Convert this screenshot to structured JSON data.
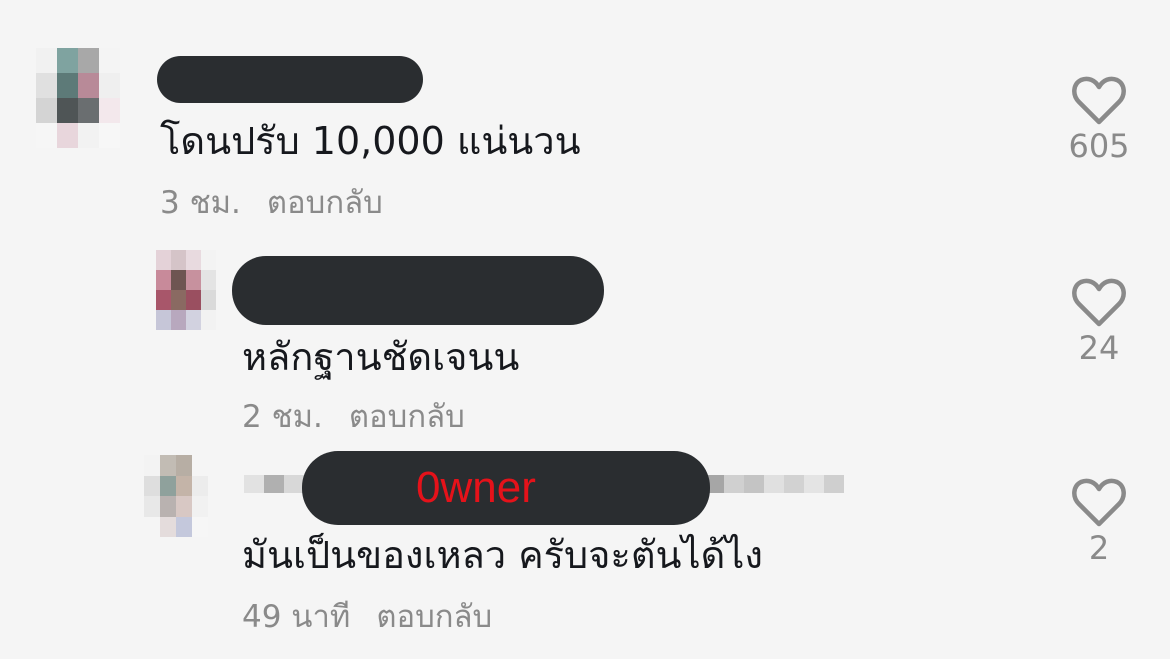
{
  "comments": [
    {
      "text": "โดนปรับ 10,000 แน่นวน",
      "time": "3 ชม.",
      "reply_label": "ตอบกลับ",
      "likes": "605"
    },
    {
      "text": "หลักฐานชัดเจนน",
      "time": "2 ชม.",
      "reply_label": "ตอบกลับ",
      "likes": "24"
    },
    {
      "text": "มันเป็นของเหลว ครับจะตันได้ไง",
      "time": "49 นาที",
      "reply_label": "ตอบกลับ",
      "likes": "2",
      "owner_label": "0wner"
    }
  ],
  "colors": {
    "background": "#f5f5f5",
    "text": "#16181d",
    "secondary_text": "#8a8a8a",
    "redaction_bar": "#2a2d30",
    "owner_label": "#e5121a"
  },
  "icons": {
    "like": "heart-outline-icon"
  }
}
